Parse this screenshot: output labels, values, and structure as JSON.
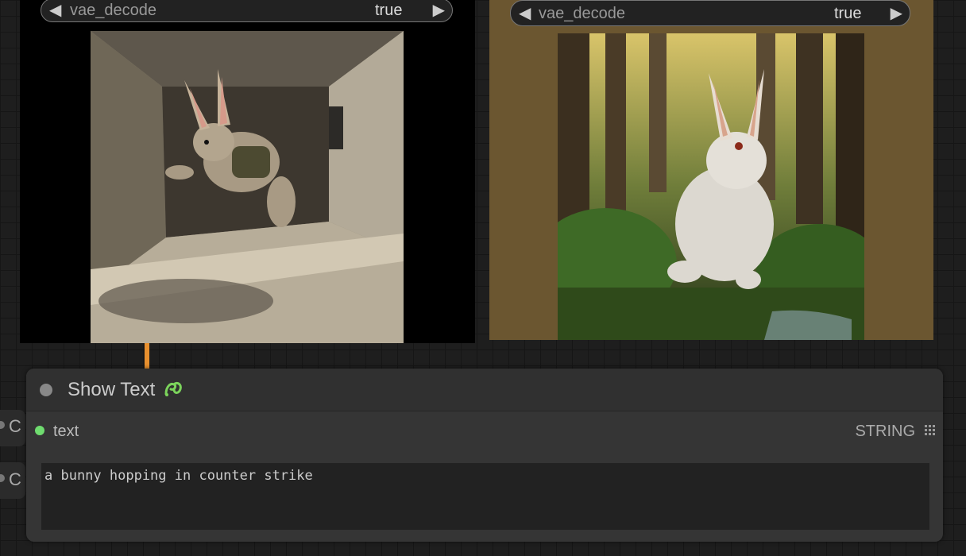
{
  "nodes": {
    "left_preview": {
      "widget": {
        "label": "vae_decode",
        "value": "true"
      }
    },
    "right_preview": {
      "widget": {
        "label": "vae_decode",
        "value": "true"
      }
    },
    "side_nodes": [
      {
        "label": "C"
      },
      {
        "label": "C"
      }
    ],
    "show_text": {
      "title": "Show Text",
      "input_label": "text",
      "output_type": "STRING",
      "text_value": "a bunny hopping in counter strike"
    }
  },
  "icons": {
    "left_arrow": "left-arrow-icon",
    "right_arrow": "right-arrow-icon",
    "custom_node_badge": "snake-badge-icon",
    "grid": "grid-icon"
  },
  "colors": {
    "wire": "#e8902e",
    "input_connected": "#6fdc6f",
    "right_node_bg": "#6b5630"
  }
}
